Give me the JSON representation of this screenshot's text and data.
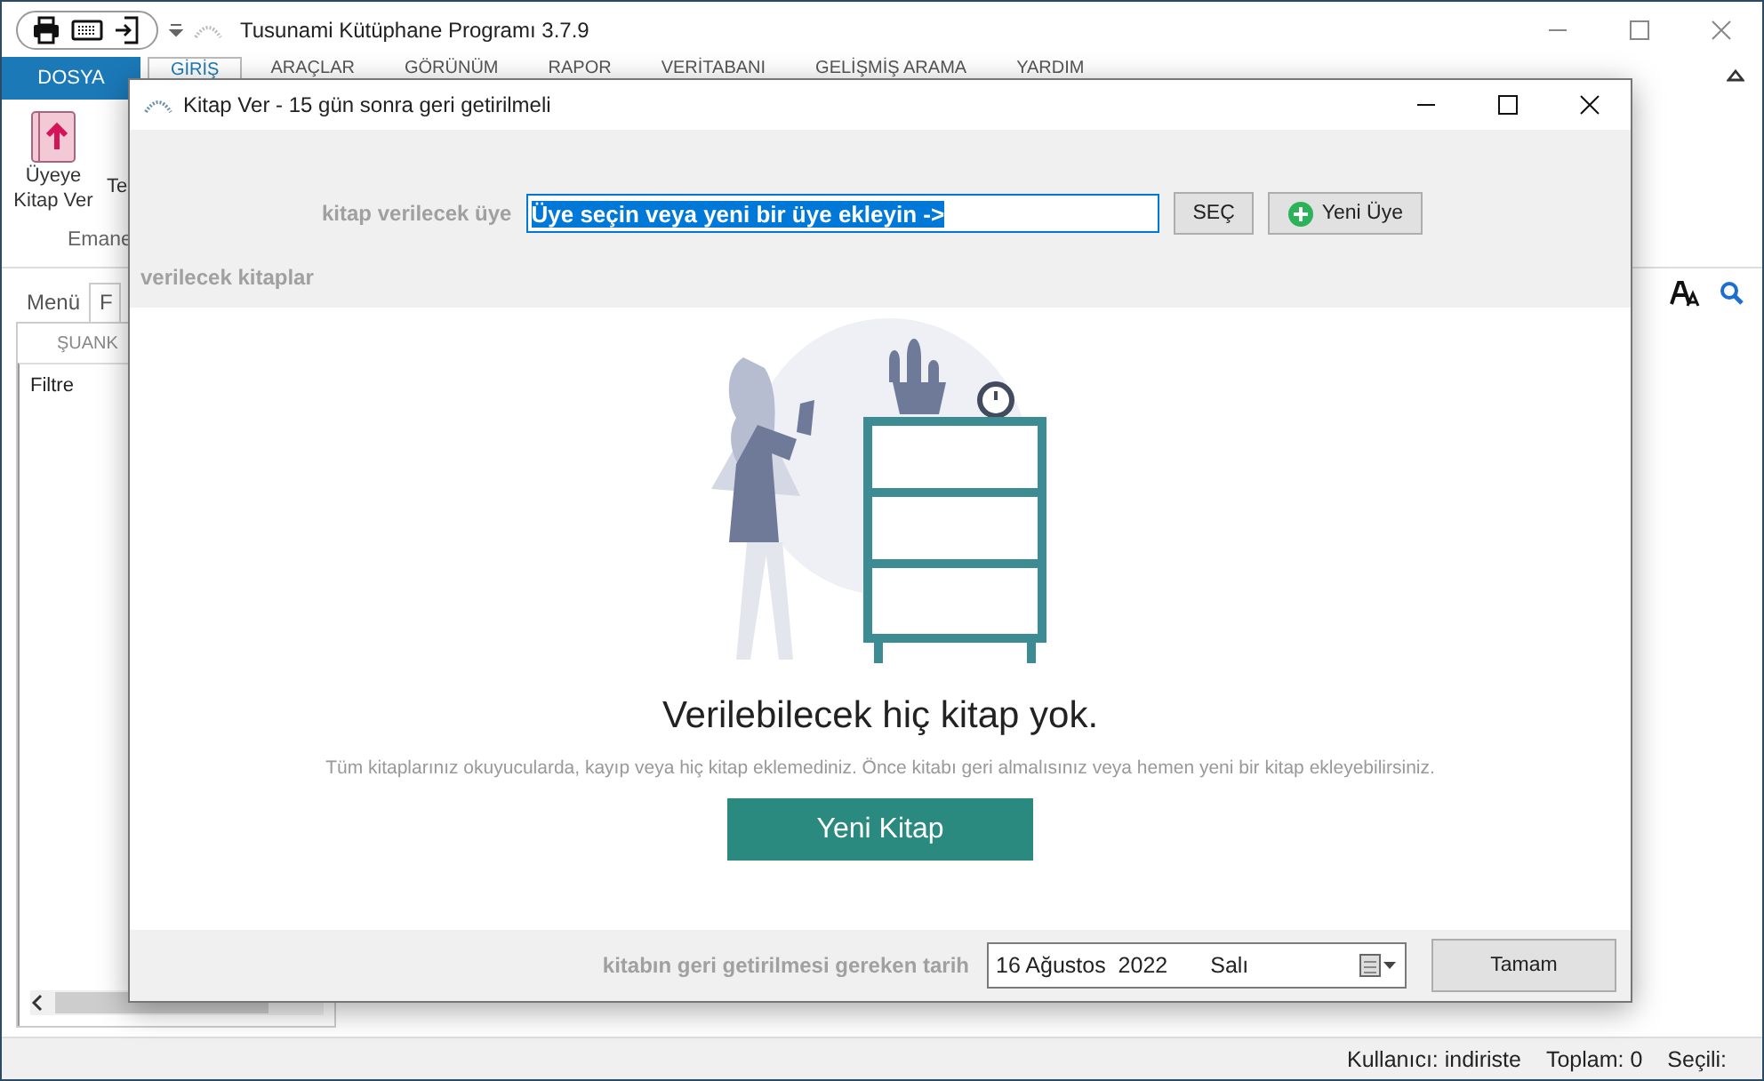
{
  "app": {
    "title": "Tusunami Kütüphane Programı 3.7.9",
    "menu_tabs": [
      {
        "label": "DOSYA",
        "kind": "file",
        "selected": false
      },
      {
        "label": "GİRİŞ",
        "kind": "tab",
        "selected": true
      },
      {
        "label": "ARAÇLAR",
        "kind": "tab",
        "selected": false
      },
      {
        "label": "GÖRÜNÜM",
        "kind": "tab",
        "selected": false
      },
      {
        "label": "RAPOR",
        "kind": "tab",
        "selected": false
      },
      {
        "label": "VERİTABANI",
        "kind": "tab",
        "selected": false
      },
      {
        "label": "GELİŞMİŞ ARAMA",
        "kind": "tab",
        "selected": false
      },
      {
        "label": "YARDIM",
        "kind": "tab",
        "selected": false
      }
    ],
    "ribbon_buttons": [
      "Üyeye Kitap Ver",
      "Te"
    ],
    "ribbon_group": "Emane",
    "side_tabs": [
      {
        "label": "Menü",
        "selected": false
      },
      {
        "label": "F",
        "selected": true
      }
    ],
    "side_header": "ŞUANK",
    "filter_label": "Filtre",
    "status": {
      "user": "Kullanıcı: indiriste",
      "total": "Toplam: 0",
      "selected": "Seçili:"
    }
  },
  "dialog": {
    "title": "Kitap Ver - 15 gün sonra geri getirilmeli",
    "member_label": "kitap verilecek üye",
    "member_value": "Üye seçin veya yeni bir üye ekleyin ->",
    "select_button": "SEÇ",
    "new_member_button": "Yeni Üye",
    "books_label": "verilecek kitaplar",
    "empty_title": "Verilebilecek hiç kitap yok.",
    "empty_text": "Tüm kitaplarınız okuyucularda, kayıp veya hiç kitap eklemediniz. Önce kitabı geri almalısınız veya hemen yeni bir kitap ekleyebilirsiniz.",
    "new_book_button": "Yeni Kitap",
    "due_label": "kitabın geri getirilmesi gereken tarih",
    "due_date": "16 Ağustos  2022",
    "due_day": "Salı",
    "ok_button": "Tamam"
  }
}
